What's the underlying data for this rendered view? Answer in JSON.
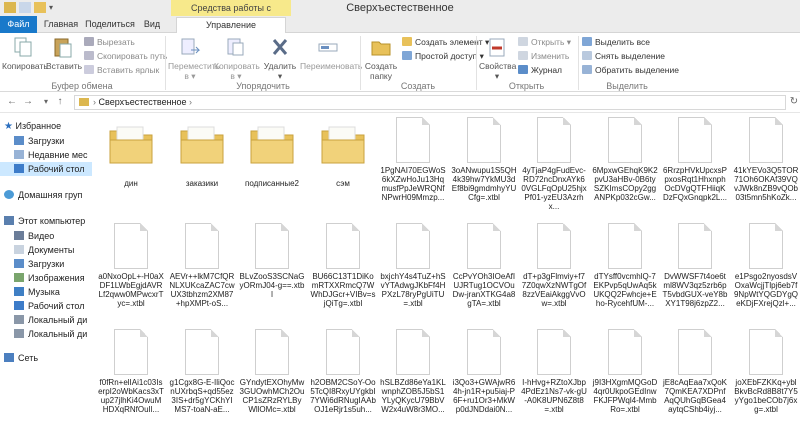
{
  "window": {
    "title": "Сверхъестественное",
    "context_band": "Средства работы с рисунками"
  },
  "tabs": [
    "Файл",
    "Главная",
    "Поделиться",
    "Вид",
    "Управление"
  ],
  "ribbon": {
    "clipboard": {
      "copy": "Копировать",
      "paste": "Вставить",
      "cut": "Вырезать",
      "copy_path": "Скопировать путь",
      "paste_shortcut": "Вставить ярлык",
      "group": "Буфер обмена"
    },
    "organize": {
      "move_to": "Переместить в",
      "copy_to": "Копировать в",
      "delete": "Удалить",
      "rename": "Переименовать",
      "group": "Упорядочить"
    },
    "new": {
      "new_folder": "Создать папку",
      "new_item": "Создать элемент",
      "easy_access": "Простой доступ",
      "group": "Создать"
    },
    "open": {
      "properties": "Свойства",
      "open": "Открыть",
      "edit": "Изменить",
      "history": "Журнал",
      "group": "Открыть"
    },
    "select": {
      "select_all": "Выделить все",
      "select_none": "Снять выделение",
      "invert": "Обратить выделение",
      "group": "Выделить"
    }
  },
  "address": {
    "path": "Сверхъестественное"
  },
  "nav": {
    "favorites": "Избранное",
    "downloads": "Загрузки",
    "recent": "Недавние мес",
    "desktop": "Рабочий стол",
    "homegroup": "Домашняя груп",
    "this_pc": "Этот компьютер",
    "video": "Видео",
    "documents": "Документы",
    "downloads2": "Загрузки",
    "pictures": "Изображения",
    "music": "Музыка",
    "desktop2": "Рабочий стол",
    "local1": "Локальный ди",
    "local2": "Локальный ди",
    "network": "Сеть"
  },
  "files": [
    {
      "name": "дин",
      "type": "folder"
    },
    {
      "name": "заказики",
      "type": "folder"
    },
    {
      "name": "подписанные2",
      "type": "folder"
    },
    {
      "name": "сэм",
      "type": "folder"
    },
    {
      "name": "1PgNAI70EGWoS6kXZwHoJu13HqmusfPpJeWRQNfNPwrH09Mmzp...",
      "type": "file"
    },
    {
      "name": "3oANwupu1S5QH4k39hw7YkMU3dEf8bi9gmdmhyYUCfg=.xtbl",
      "type": "file"
    },
    {
      "name": "4yTjaP4gFudEvc-RD72ncDnxAYk60VGLFqOpU25hjxPf01-yzEU3Azrhx...",
      "type": "file"
    },
    {
      "name": "6MpxwGEhqK9K2pvU3aHBv-0B6tySZKImsCOpy2ggANPKp032cGw...",
      "type": "file"
    },
    {
      "name": "6RrzpHVkUpcxsPpxosRqt1HhxnphOcDVgQTFHiiqKDzFQxGnqpk2L...",
      "type": "file"
    },
    {
      "name": "41kYEVo3Q5TOR71Oh6OKAf39VQvJWk8nZB9vQOb03t5mn5hKoZk...",
      "type": "file"
    },
    {
      "name": "a0NxoOpL+-H0aXDF1LWbEgjdAVRLf2qww0MPwcxrTyc=.xtbl",
      "type": "file"
    },
    {
      "name": "AEVr++lkM7CfQRNLXUKcaZAC7cwUX3tbhzm2XM87+hpXMPt-oS...",
      "type": "file"
    },
    {
      "name": "BLvZooS3SCNaGyORmJ04-g==.xtbl",
      "type": "file"
    },
    {
      "name": "BU66C13T1DiKomRTXXRmcQ7WWhDJGcr+VIBv=sjQiTg=.xtbl",
      "type": "file"
    },
    {
      "name": "bxjchY4s4TuZ+hSvYTAdwgJKbFf4HPXzL78ryPgUiTU=.xtbl",
      "type": "file"
    },
    {
      "name": "CcPvYOh3IOeAfIUJRTug1OCVOuDw-jranXTKG4a8gTA=.xtbl",
      "type": "file"
    },
    {
      "name": "dT+p3gFlmviy+f77Z0qwXzNWTgOf8zzVEaiAkggVvOw=.xtbl",
      "type": "file"
    },
    {
      "name": "dTYsff0vcmhlQ-7EKPvp5qUwAq5kUKQQ2Fwhcje+Eho-RycehfUM-...",
      "type": "file"
    },
    {
      "name": "DvWWSF7t4oe6tml8WV3qz5zrb6pT5vbdGUX-veY8bXY1T98j6zpZ2...",
      "type": "file"
    },
    {
      "name": "e1Psgo2nyosdsVOxaWcjjTlpj6eb7f9NpWtYQGDYgQeKDjFXrejQzl+...",
      "type": "file"
    },
    {
      "name": "f0fRn+elIAi1c03IserpI2oWbKacs3xTup27jlhKi4OwuMHDXqRNfOuIl...",
      "type": "file"
    },
    {
      "name": "g1Cgx8G-E-IliQocnUXrbqS+qd55ez3IS+dr5gYCKhYIMS7-toaN-aE...",
      "type": "file"
    },
    {
      "name": "GYndytEXOhyMw3GUOwhMCh2OuCP1sZRzRYLByWllOMc=.xtbl",
      "type": "file"
    },
    {
      "name": "h2OBM2CSoY-Oo5TcQI8RxyUYgkbI7YWi6dRNugIAAbOJ1eRjr1s5uh...",
      "type": "file"
    },
    {
      "name": "hSLBZd86eYa1KLwnphZOB5J5bS1YLyQKycU79BbVW2x4uW8r3MO...",
      "type": "file"
    },
    {
      "name": "i3Qo3+GWAjwR64h-jn1R+pu5iaj-P6F+ru1Or3+MkWp0dJNDdai0N...",
      "type": "file"
    },
    {
      "name": "I-hHvg+RZtoXJbp4PdEz1Ns7-vk-gU-A0K8UPN6Z8t8=.xtbl",
      "type": "file"
    },
    {
      "name": "j9I3HXgmMQGoD4qr0UkpoGEdInwFKJFPWql4-MmbRo=.xtbl",
      "type": "file"
    },
    {
      "name": "jE8cAqEaa7xQoK7QmKEA7XDPnfAqQUhGqBGea4aytqCShb4iyj...",
      "type": "file"
    },
    {
      "name": "joXEbFZKKq+yblBkvBcRd8B8t7Y5yYgo1beCOb7j6xg=.xtbl",
      "type": "file"
    }
  ],
  "colors": {
    "accent": "#1979ca",
    "context_band": "#f7e98b",
    "selection": "#cce8ff",
    "folder": "#e8c15a"
  }
}
